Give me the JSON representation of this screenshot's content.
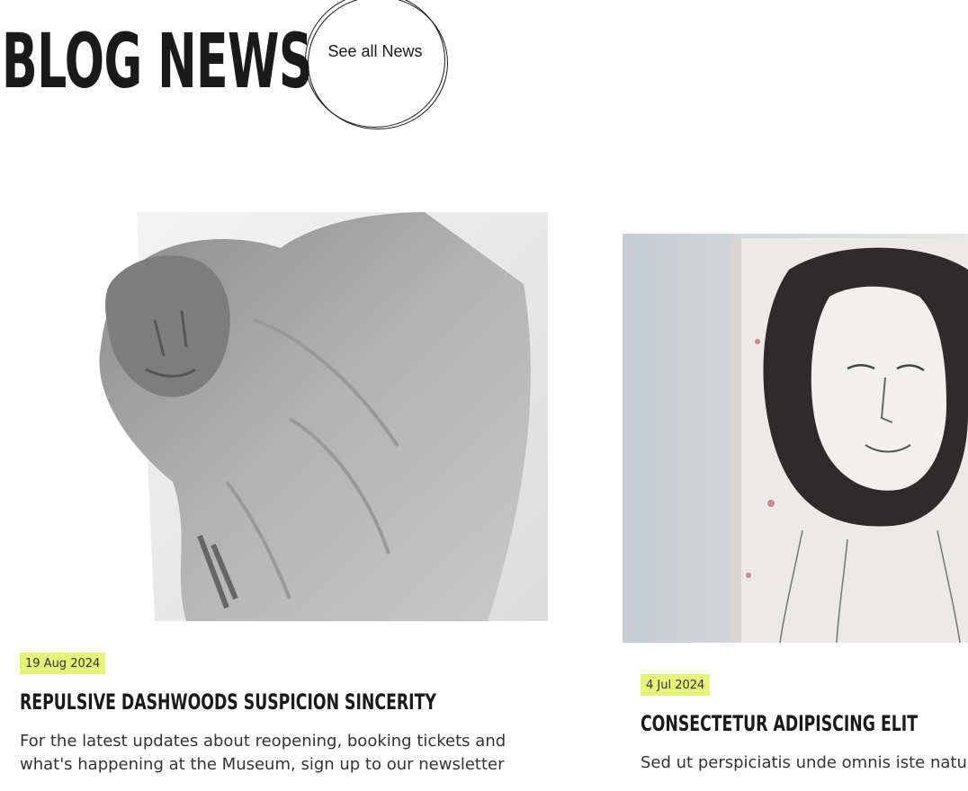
{
  "header": {
    "title": "BLOG NEWS",
    "see_all": "See all News"
  },
  "posts": [
    {
      "date": "19 Aug 2024",
      "title": "REPULSIVE DASHWOODS SUSPICION SINCERITY",
      "excerpt": "For the latest updates about reopening, booking tickets and what's happening at the Museum, sign up to our newsletter",
      "image": "statue-photo"
    },
    {
      "date": "4 Jul 2024",
      "title": "CONSECTETUR ADIPISCING ELIT",
      "excerpt": "Sed ut perspiciatis unde omnis iste natus e",
      "image": "portrait-painting"
    }
  ],
  "colors": {
    "date_badge_bg": "#e4f47a",
    "text": "#1a1a1a"
  }
}
